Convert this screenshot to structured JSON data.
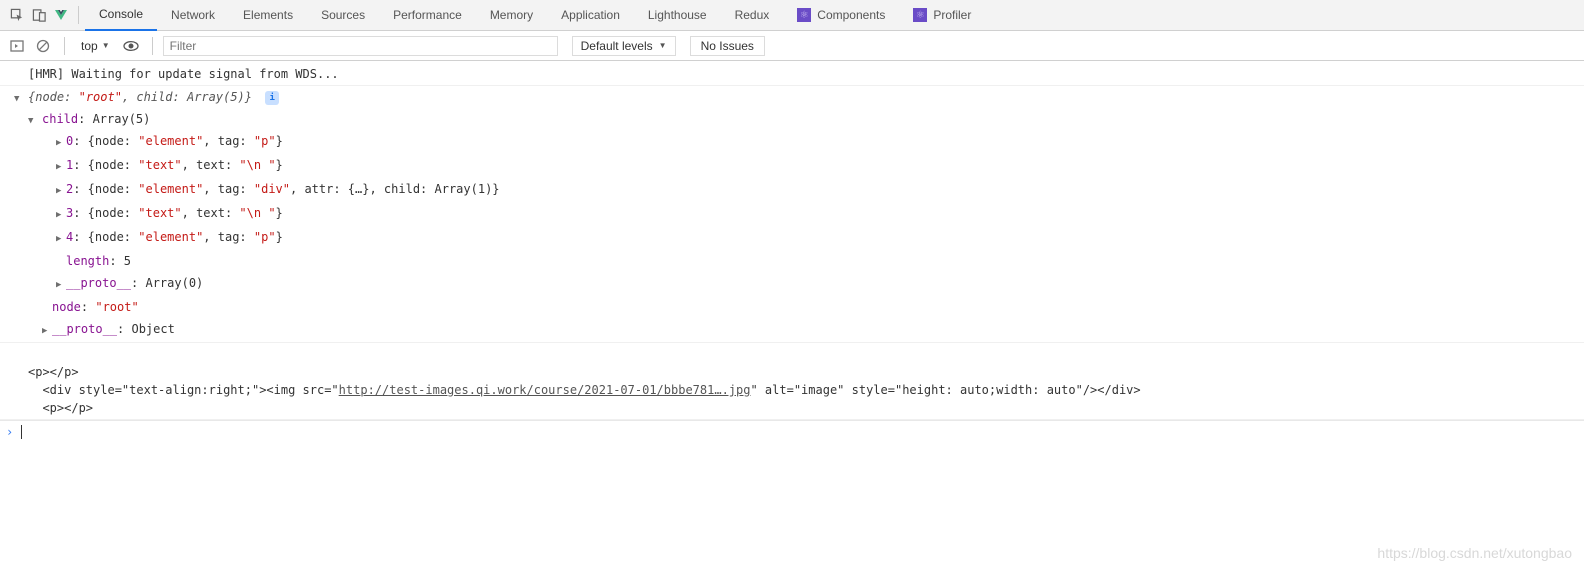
{
  "tabs": {
    "console": "Console",
    "network": "Network",
    "elements": "Elements",
    "sources": "Sources",
    "performance": "Performance",
    "memory": "Memory",
    "application": "Application",
    "lighthouse": "Lighthouse",
    "redux": "Redux",
    "components": "Components",
    "profiler": "Profiler"
  },
  "toolbar": {
    "context": "top",
    "filter_placeholder": "Filter",
    "levels": "Default levels",
    "noissues": "No Issues"
  },
  "console": {
    "hmr": "[HMR] Waiting for update signal from WDS...",
    "obj_summary_pre": "{",
    "obj_summary_node_k": "node: ",
    "obj_summary_node_v": "\"root\"",
    "obj_summary_sep": ", ",
    "obj_summary_child": "child: Array(5)",
    "obj_summary_post": "}",
    "child_header_k": "child",
    "child_header_v": ": Array(5)",
    "items": [
      {
        "idx": "0",
        "body": ": {node: ",
        "str": "\"element\"",
        "mid": ", tag: ",
        "str2": "\"p\"",
        "post": "}"
      },
      {
        "idx": "1",
        "body": ": {node: ",
        "str": "\"text\"",
        "mid": ", text: ",
        "str2": "\"\\n  \"",
        "post": "}"
      },
      {
        "idx": "2",
        "body": ": {node: ",
        "str": "\"element\"",
        "mid": ", tag: ",
        "str2": "\"div\"",
        "post": ", attr: {…}, child: Array(1)}"
      },
      {
        "idx": "3",
        "body": ": {node: ",
        "str": "\"text\"",
        "mid": ", text: ",
        "str2": "\"\\n  \"",
        "post": "}"
      },
      {
        "idx": "4",
        "body": ": {node: ",
        "str": "\"element\"",
        "mid": ", tag: ",
        "str2": "\"p\"",
        "post": "}"
      }
    ],
    "length_k": "length",
    "length_v": ": 5",
    "proto_arr_k": "__proto__",
    "proto_arr_v": ": Array(0)",
    "outer_node_k": "node",
    "outer_node_v": ": ",
    "outer_node_s": "\"root\"",
    "proto_obj_k": "__proto__",
    "proto_obj_v": ": Object",
    "html": {
      "p1": "<p></p>",
      "div_pre": "  <div style=\"text-align:right;\"><img src=\"",
      "div_url": "http://test-images.qi.work/course/2021-07-01/bbbe781….jpg",
      "div_post": "\" alt=\"image\" style=\"height: auto;width: auto\"/></div>",
      "p2": "  <p></p>"
    }
  },
  "watermark": "https://blog.csdn.net/xutongbao"
}
